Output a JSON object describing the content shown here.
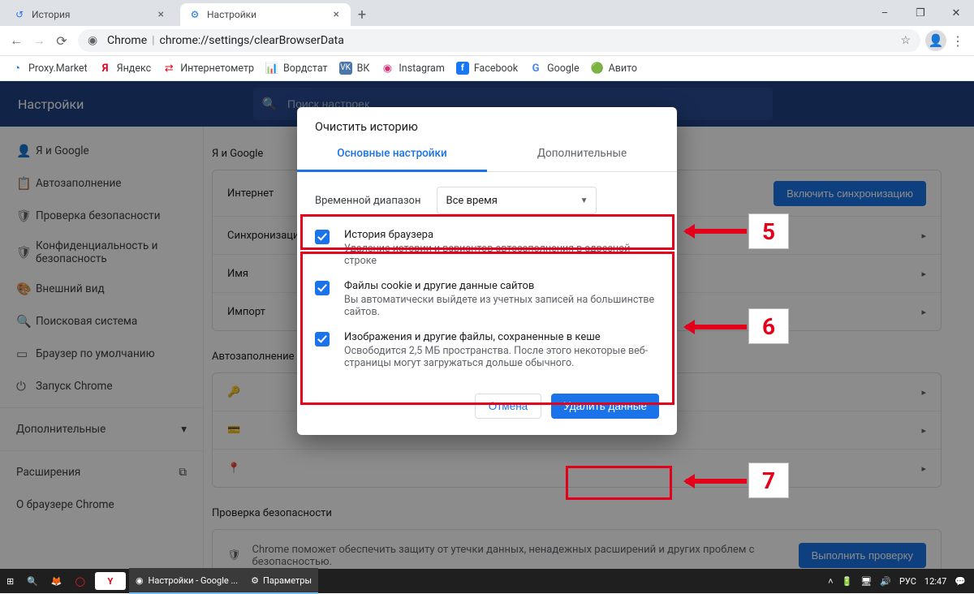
{
  "window": {
    "minimize": "–",
    "maximize": "❐",
    "close": "✕"
  },
  "tabs": [
    {
      "label": "История",
      "active": false
    },
    {
      "label": "Настройки",
      "active": true
    }
  ],
  "address": {
    "scheme": "Chrome",
    "url": "chrome://settings/clearBrowserData"
  },
  "bookmarks": [
    {
      "label": "Proxy.Market"
    },
    {
      "label": "Яндекс"
    },
    {
      "label": "Интернетометр"
    },
    {
      "label": "Вордстат"
    },
    {
      "label": "ВК"
    },
    {
      "label": "Instagram"
    },
    {
      "label": "Facebook"
    },
    {
      "label": "Google"
    },
    {
      "label": "Авито"
    }
  ],
  "settings": {
    "title": "Настройки",
    "search_placeholder": "Поиск настроек",
    "sidebar": [
      {
        "icon": "person",
        "label": "Я и Google"
      },
      {
        "icon": "clipboard",
        "label": "Автозаполнение"
      },
      {
        "icon": "shield-check",
        "label": "Проверка безопасности"
      },
      {
        "icon": "shield",
        "label": "Конфиденциальность и безопасность"
      },
      {
        "icon": "palette",
        "label": "Внешний вид"
      },
      {
        "icon": "search",
        "label": "Поисковая система"
      },
      {
        "icon": "window",
        "label": "Браузер по умолчанию"
      },
      {
        "icon": "power",
        "label": "Запуск Chrome"
      }
    ],
    "sidebar_more": "Дополнительные",
    "sidebar_ext": "Расширения",
    "sidebar_about": "О браузере Chrome"
  },
  "main": {
    "section1": "Я и Google",
    "row1a": "Интернет",
    "row1b": "Синхронизация",
    "sync_btn": "Включить синхронизацию",
    "row2": "Синхронизация",
    "row3": "Имя",
    "row4": "Импорт",
    "section2": "Автозаполнение",
    "section3": "Проверка безопасности",
    "safety_text": "Chrome поможет обеспечить защиту от утечки данных, ненадежных расширений и других проблем с безопасностью.",
    "safety_btn": "Выполнить проверку"
  },
  "dialog": {
    "title": "Очистить историю",
    "tab_basic": "Основные настройки",
    "tab_adv": "Дополнительные",
    "range_label": "Временной диапазон",
    "range_value": "Все время",
    "items": [
      {
        "title": "История браузера",
        "desc": "Удаление истории и вариантов автозаполнения в адресной строке"
      },
      {
        "title": "Файлы cookie и другие данные сайтов",
        "desc": "Вы автоматически выйдете из учетных записей на большинстве сайтов."
      },
      {
        "title": "Изображения и другие файлы, сохраненные в кеше",
        "desc": "Освободится 2,5 МБ пространства. После этого некоторые веб-страницы могут загружаться дольше обычного."
      }
    ],
    "cancel": "Отмена",
    "confirm": "Удалить данные"
  },
  "annotations": {
    "n5": "5",
    "n6": "6",
    "n7": "7"
  },
  "taskbar": {
    "app": "Настройки - Google ...",
    "params": "Параметры",
    "lang": "РУС",
    "time": "12:47"
  }
}
